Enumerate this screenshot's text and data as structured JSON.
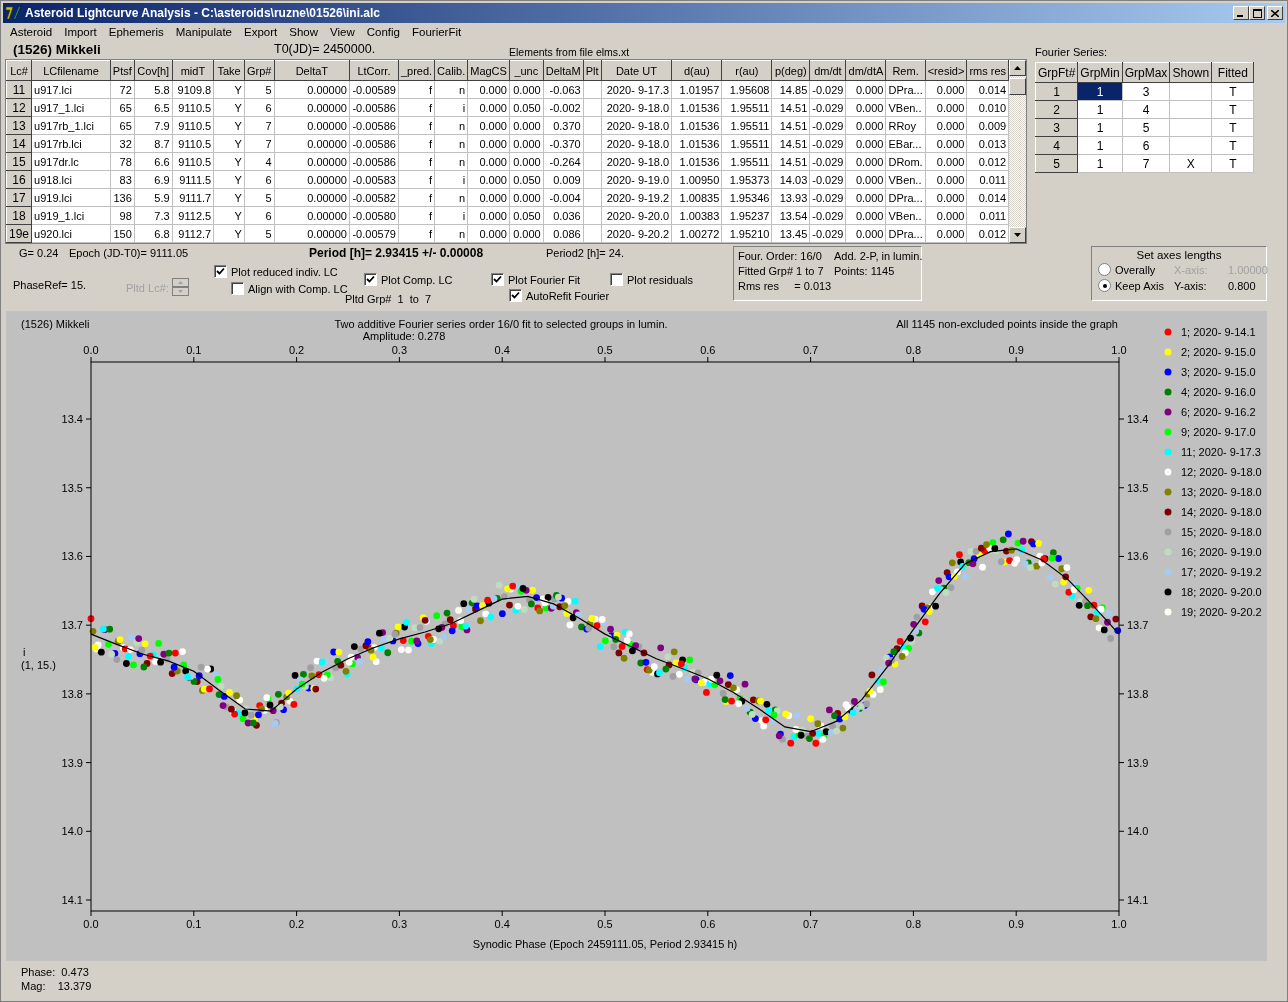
{
  "window": {
    "title": "Asteroid Lightcurve Analysis - C:\\asteroids\\ruzne\\01526\\ini.alc"
  },
  "menu": [
    "Asteroid",
    "Import",
    "Ephemeris",
    "Manipulate",
    "Export",
    "Show",
    "View",
    "Config",
    "FourierFit"
  ],
  "header": {
    "asteroid": "(1526) Mikkeli",
    "t0": "T0(JD)= 2450000.",
    "elements": "Elements from file elms.xt",
    "fourier_label": "Fourier Series:"
  },
  "lc_table": {
    "columns": [
      "Lc#",
      "LCfilename",
      "Ptsf",
      "Cov[h]",
      "midT",
      "Take",
      "Grp#",
      "DeltaT",
      "LtCorr.",
      "_pred.",
      "Calib.",
      "MagCS",
      "_unc",
      "DeltaM",
      "Plt",
      "Date UT",
      "d(au)",
      "r(au)",
      "p(deg)",
      "dm/dt",
      "dm/dtA",
      "Rem.",
      "<resid>",
      "rms res"
    ],
    "rows": [
      {
        "cells": [
          "11",
          "u917.lci",
          "72",
          "5.8",
          "9109.8",
          "Y",
          "5",
          "0.00000",
          "-0.00589",
          "f",
          "n",
          "0.000",
          "0.000",
          "-0.063",
          null,
          "2020- 9-17.3",
          "1.01957",
          "1.95608",
          "14.85",
          "-0.029",
          "0.000",
          "DPra...",
          "0.000",
          "0.014"
        ]
      },
      {
        "cells": [
          "12",
          "u917_1.lci",
          "65",
          "6.5",
          "9110.5",
          "Y",
          "6",
          "0.00000",
          "-0.00586",
          "f",
          "i",
          "0.000",
          "0.050",
          "-0.002",
          null,
          "2020- 9-18.0",
          "1.01536",
          "1.95511",
          "14.51",
          "-0.029",
          "0.000",
          "VBen..",
          "0.000",
          "0.010"
        ]
      },
      {
        "cells": [
          "13",
          "u917rb_1.lci",
          "65",
          "7.9",
          "9110.5",
          "Y",
          "7",
          "0.00000",
          "-0.00586",
          "f",
          "n",
          "0.000",
          "0.000",
          "0.370",
          null,
          "2020- 9-18.0",
          "1.01536",
          "1.95511",
          "14.51",
          "-0.029",
          "0.000",
          "RRoy",
          "0.000",
          "0.009"
        ]
      },
      {
        "cells": [
          "14",
          "u917rb.lci",
          "32",
          "8.7",
          "9110.5",
          "Y",
          "7",
          "0.00000",
          "-0.00586",
          "f",
          "n",
          "0.000",
          "0.000",
          "-0.370",
          null,
          "2020- 9-18.0",
          "1.01536",
          "1.95511",
          "14.51",
          "-0.029",
          "0.000",
          "EBar...",
          "0.000",
          "0.013"
        ]
      },
      {
        "cells": [
          "15",
          "u917dr.lc",
          "78",
          "6.6",
          "9110.5",
          "Y",
          "4",
          "0.00000",
          "-0.00586",
          "f",
          "n",
          "0.000",
          "0.000",
          "-0.264",
          null,
          "2020- 9-18.0",
          "1.01536",
          "1.95511",
          "14.51",
          "-0.029",
          "0.000",
          "DRom.",
          "0.000",
          "0.012"
        ]
      },
      {
        "cells": [
          "16",
          "u918.lci",
          "83",
          "6.9",
          "9111.5",
          "Y",
          "6",
          "0.00000",
          "-0.00583",
          "f",
          "i",
          "0.000",
          "0.050",
          "0.009",
          null,
          "2020- 9-19.0",
          "1.00950",
          "1.95373",
          "14.03",
          "-0.029",
          "0.000",
          "VBen..",
          "0.000",
          "0.011"
        ]
      },
      {
        "cells": [
          "17",
          "u919.lci",
          "136",
          "5.9",
          "9111.7",
          "Y",
          "5",
          "0.00000",
          "-0.00582",
          "f",
          "n",
          "0.000",
          "0.000",
          "-0.004",
          null,
          "2020- 9-19.2",
          "1.00835",
          "1.95346",
          "13.93",
          "-0.029",
          "0.000",
          "DPra...",
          "0.000",
          "0.014"
        ]
      },
      {
        "cells": [
          "18",
          "u919_1.lci",
          "98",
          "7.3",
          "9112.5",
          "Y",
          "6",
          "0.00000",
          "-0.00580",
          "f",
          "i",
          "0.000",
          "0.050",
          "0.036",
          null,
          "2020- 9-20.0",
          "1.00383",
          "1.95237",
          "13.54",
          "-0.029",
          "0.000",
          "VBen..",
          "0.000",
          "0.011"
        ]
      },
      {
        "cells": [
          "19e",
          "u920.lci",
          "150",
          "6.8",
          "9112.7",
          "Y",
          "5",
          "0.00000",
          "-0.00579",
          "f",
          "n",
          "0.000",
          "0.000",
          "0.086",
          null,
          "2020- 9-20.2",
          "1.00272",
          "1.95210",
          "13.45",
          "-0.029",
          "0.000",
          "DPra...",
          "0.000",
          "0.012"
        ]
      }
    ]
  },
  "fourier_table": {
    "columns": [
      "GrpFt#",
      "GrpMin",
      "GrpMax",
      "Shown",
      "Fitted"
    ],
    "rows": [
      {
        "cells": [
          "1",
          "1",
          "3",
          null,
          "T"
        ],
        "selected": true
      },
      {
        "cells": [
          "2",
          "1",
          "4",
          null,
          "T"
        ],
        "selected": false
      },
      {
        "cells": [
          "3",
          "1",
          "5",
          null,
          "T"
        ],
        "selected": false
      },
      {
        "cells": [
          "4",
          "1",
          "6",
          null,
          "T"
        ],
        "selected": false
      },
      {
        "cells": [
          "5",
          "1",
          "7",
          "X",
          "T"
        ],
        "selected": false
      }
    ]
  },
  "controls": {
    "g": "G= 0.24",
    "epoch": "Epoch (JD-T0)= 9111.05",
    "period": "Period [h]= 2.93415 +/- 0.00008",
    "period2": "Period2 [h]= 24.",
    "phaseref": "PhaseRef= 15.",
    "pltd_lc": {
      "label": "Pltd Lc#:",
      "disabled": true
    },
    "checkboxes": [
      {
        "label": "Plot reduced indiv. LC",
        "checked": true
      },
      {
        "label": "Align with Comp. LC",
        "checked": false
      },
      {
        "label": "Plot Comp. LC",
        "checked": true
      },
      {
        "label": "Plot Fourier Fit",
        "checked": true
      },
      {
        "label": "Plot residuals",
        "checked": false
      },
      {
        "label": "AutoRefit Fourier",
        "checked": true
      }
    ],
    "pltd_grp": "Pltd Grp#  1  to  7"
  },
  "info_box": [
    "Four. Order: 16/0",
    "Add. 2-P, in lumin.",
    "Fitted Grp# 1 to 7",
    "Points: 1145",
    "Rms res     = 0.013"
  ],
  "axes": {
    "title": "Set axes lengths",
    "options": [
      {
        "label": "Overally",
        "selected": false
      },
      {
        "label": "Keep Axis",
        "selected": true
      }
    ],
    "fields": [
      {
        "label": "X-axis:",
        "value": "1.00000",
        "disabled": true
      },
      {
        "label": "Y-axis:",
        "value": "0.800",
        "disabled": false
      }
    ]
  },
  "chart": {
    "object": "(1526) Mikkeli",
    "subtitle": "Two additive Fourier series order 16/0 fit to selected groups in lumin.",
    "amplitude": "Amplitude: 0.278",
    "note": "All 1145 non-excluded points inside the graph",
    "ylabel_note": "(1, 15.)",
    "chart_data": {
      "type": "line",
      "xlabel": "Synodic Phase (Epoch 2459111.05, Period 2.93415 h)",
      "ylabel": "i",
      "x": [
        0,
        0.025,
        0.05,
        0.075,
        0.1,
        0.125,
        0.15,
        0.175,
        0.2,
        0.225,
        0.25,
        0.275,
        0.3,
        0.325,
        0.35,
        0.375,
        0.4,
        0.425,
        0.45,
        0.475,
        0.5,
        0.525,
        0.55,
        0.575,
        0.6,
        0.625,
        0.65,
        0.675,
        0.7,
        0.725,
        0.75,
        0.775,
        0.8,
        0.825,
        0.85,
        0.875,
        0.9,
        0.925,
        0.95,
        0.975,
        1
      ],
      "series": [
        {
          "color": "#000000",
          "values": [
            13.713,
            13.728,
            13.742,
            13.752,
            13.767,
            13.795,
            13.822,
            13.825,
            13.793,
            13.768,
            13.749,
            13.733,
            13.72,
            13.71,
            13.698,
            13.68,
            13.662,
            13.658,
            13.669,
            13.69,
            13.713,
            13.731,
            13.749,
            13.763,
            13.778,
            13.798,
            13.822,
            13.848,
            13.855,
            13.84,
            13.808,
            13.76,
            13.706,
            13.655,
            13.611,
            13.593,
            13.589,
            13.605,
            13.633,
            13.672,
            13.713
          ]
        }
      ],
      "xlim": [
        0,
        1
      ],
      "ylim": [
        14.116,
        13.317
      ],
      "xticks": [
        {
          "value": 0,
          "label": "0.0"
        },
        {
          "value": 0.1,
          "label": "0.1"
        },
        {
          "value": 0.2,
          "label": "0.2"
        },
        {
          "value": 0.3,
          "label": "0.3"
        },
        {
          "value": 0.4,
          "label": "0.4"
        },
        {
          "value": 0.5,
          "label": "0.5"
        },
        {
          "value": 0.6,
          "label": "0.6"
        },
        {
          "value": 0.7,
          "label": "0.7"
        },
        {
          "value": 0.8,
          "label": "0.8"
        },
        {
          "value": 0.9,
          "label": "0.9"
        },
        {
          "value": 1,
          "label": "1.0"
        }
      ],
      "yticks": [
        13.4,
        13.5,
        13.6,
        13.7,
        13.8,
        13.9,
        {
          "value": 14,
          "label": "14.0"
        },
        14.1
      ]
    },
    "right_yticks": [
      "13.4",
      "13.5",
      "13.6",
      "13.7",
      "13.8",
      "13.9",
      "14.0",
      "14.1"
    ],
    "legend": [
      {
        "label": "1; 2020- 9-14.1",
        "color": "#ff0000"
      },
      {
        "label": "2; 2020- 9-15.0",
        "color": "#ffff00"
      },
      {
        "label": "3; 2020- 9-15.0",
        "color": "#0000ff"
      },
      {
        "label": "4; 2020- 9-16.0",
        "color": "#008000"
      },
      {
        "label": "6; 2020- 9-16.2",
        "color": "#800080"
      },
      {
        "label": "9; 2020- 9-17.0",
        "color": "#00ff00"
      },
      {
        "label": "11; 2020- 9-17.3",
        "color": "#00ffff"
      },
      {
        "label": "12; 2020- 9-18.0",
        "color": "#ffffff"
      },
      {
        "label": "13; 2020- 9-18.0",
        "color": "#808000"
      },
      {
        "label": "14; 2020- 9-18.0",
        "color": "#800000"
      },
      {
        "label": "15; 2020- 9-18.0",
        "color": "#a0a0a4"
      },
      {
        "label": "16; 2020- 9-19.0",
        "color": "#c0dcc0"
      },
      {
        "label": "17; 2020- 9-19.2",
        "color": "#a6caf0"
      },
      {
        "label": "18; 2020- 9-20.0",
        "color": "#000000"
      },
      {
        "label": "19; 2020- 9-20.2",
        "color": "#fffbf0"
      }
    ]
  },
  "status": [
    "Phase:  0.473",
    "Mag:    13.379"
  ]
}
